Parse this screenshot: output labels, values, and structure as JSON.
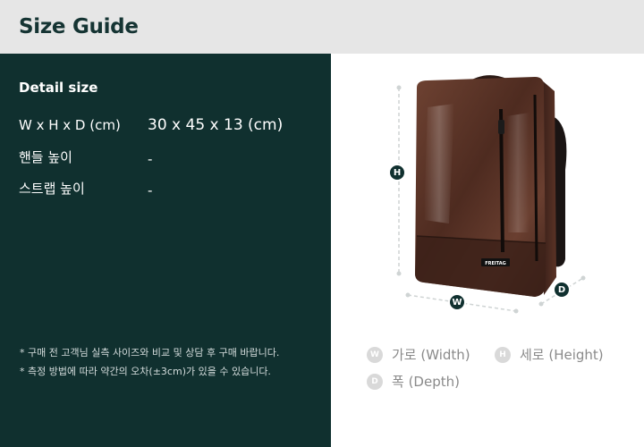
{
  "header": {
    "title": "Size Guide"
  },
  "detail": {
    "title": "Detail size",
    "rows": [
      {
        "label": "W x H x D (cm)",
        "value": "30 x 45 x 13 (cm)"
      },
      {
        "label": "핸들 높이",
        "value": "-"
      },
      {
        "label": "스트랩 높이",
        "value": "-"
      }
    ]
  },
  "notes": [
    "* 구매 전 고객님 실측 사이즈와 비교 및 상담 후 구매 바랍니다.",
    "* 측정 방법에 따라 약간의 오차(±3cm)가 있을 수 있습니다."
  ],
  "diagram": {
    "badges": {
      "h": "H",
      "w": "W",
      "d": "D"
    },
    "brand_label": "FREITAG"
  },
  "legend": {
    "width": {
      "letter": "W",
      "label": "가로 (Width)"
    },
    "height": {
      "letter": "H",
      "label": "세로 (Height)"
    },
    "depth": {
      "letter": "D",
      "label": "폭 (Depth)"
    }
  },
  "colors": {
    "dark_green": "#10302f",
    "header_bg": "#e6e6e6",
    "bag_brown": "#5a3326"
  }
}
